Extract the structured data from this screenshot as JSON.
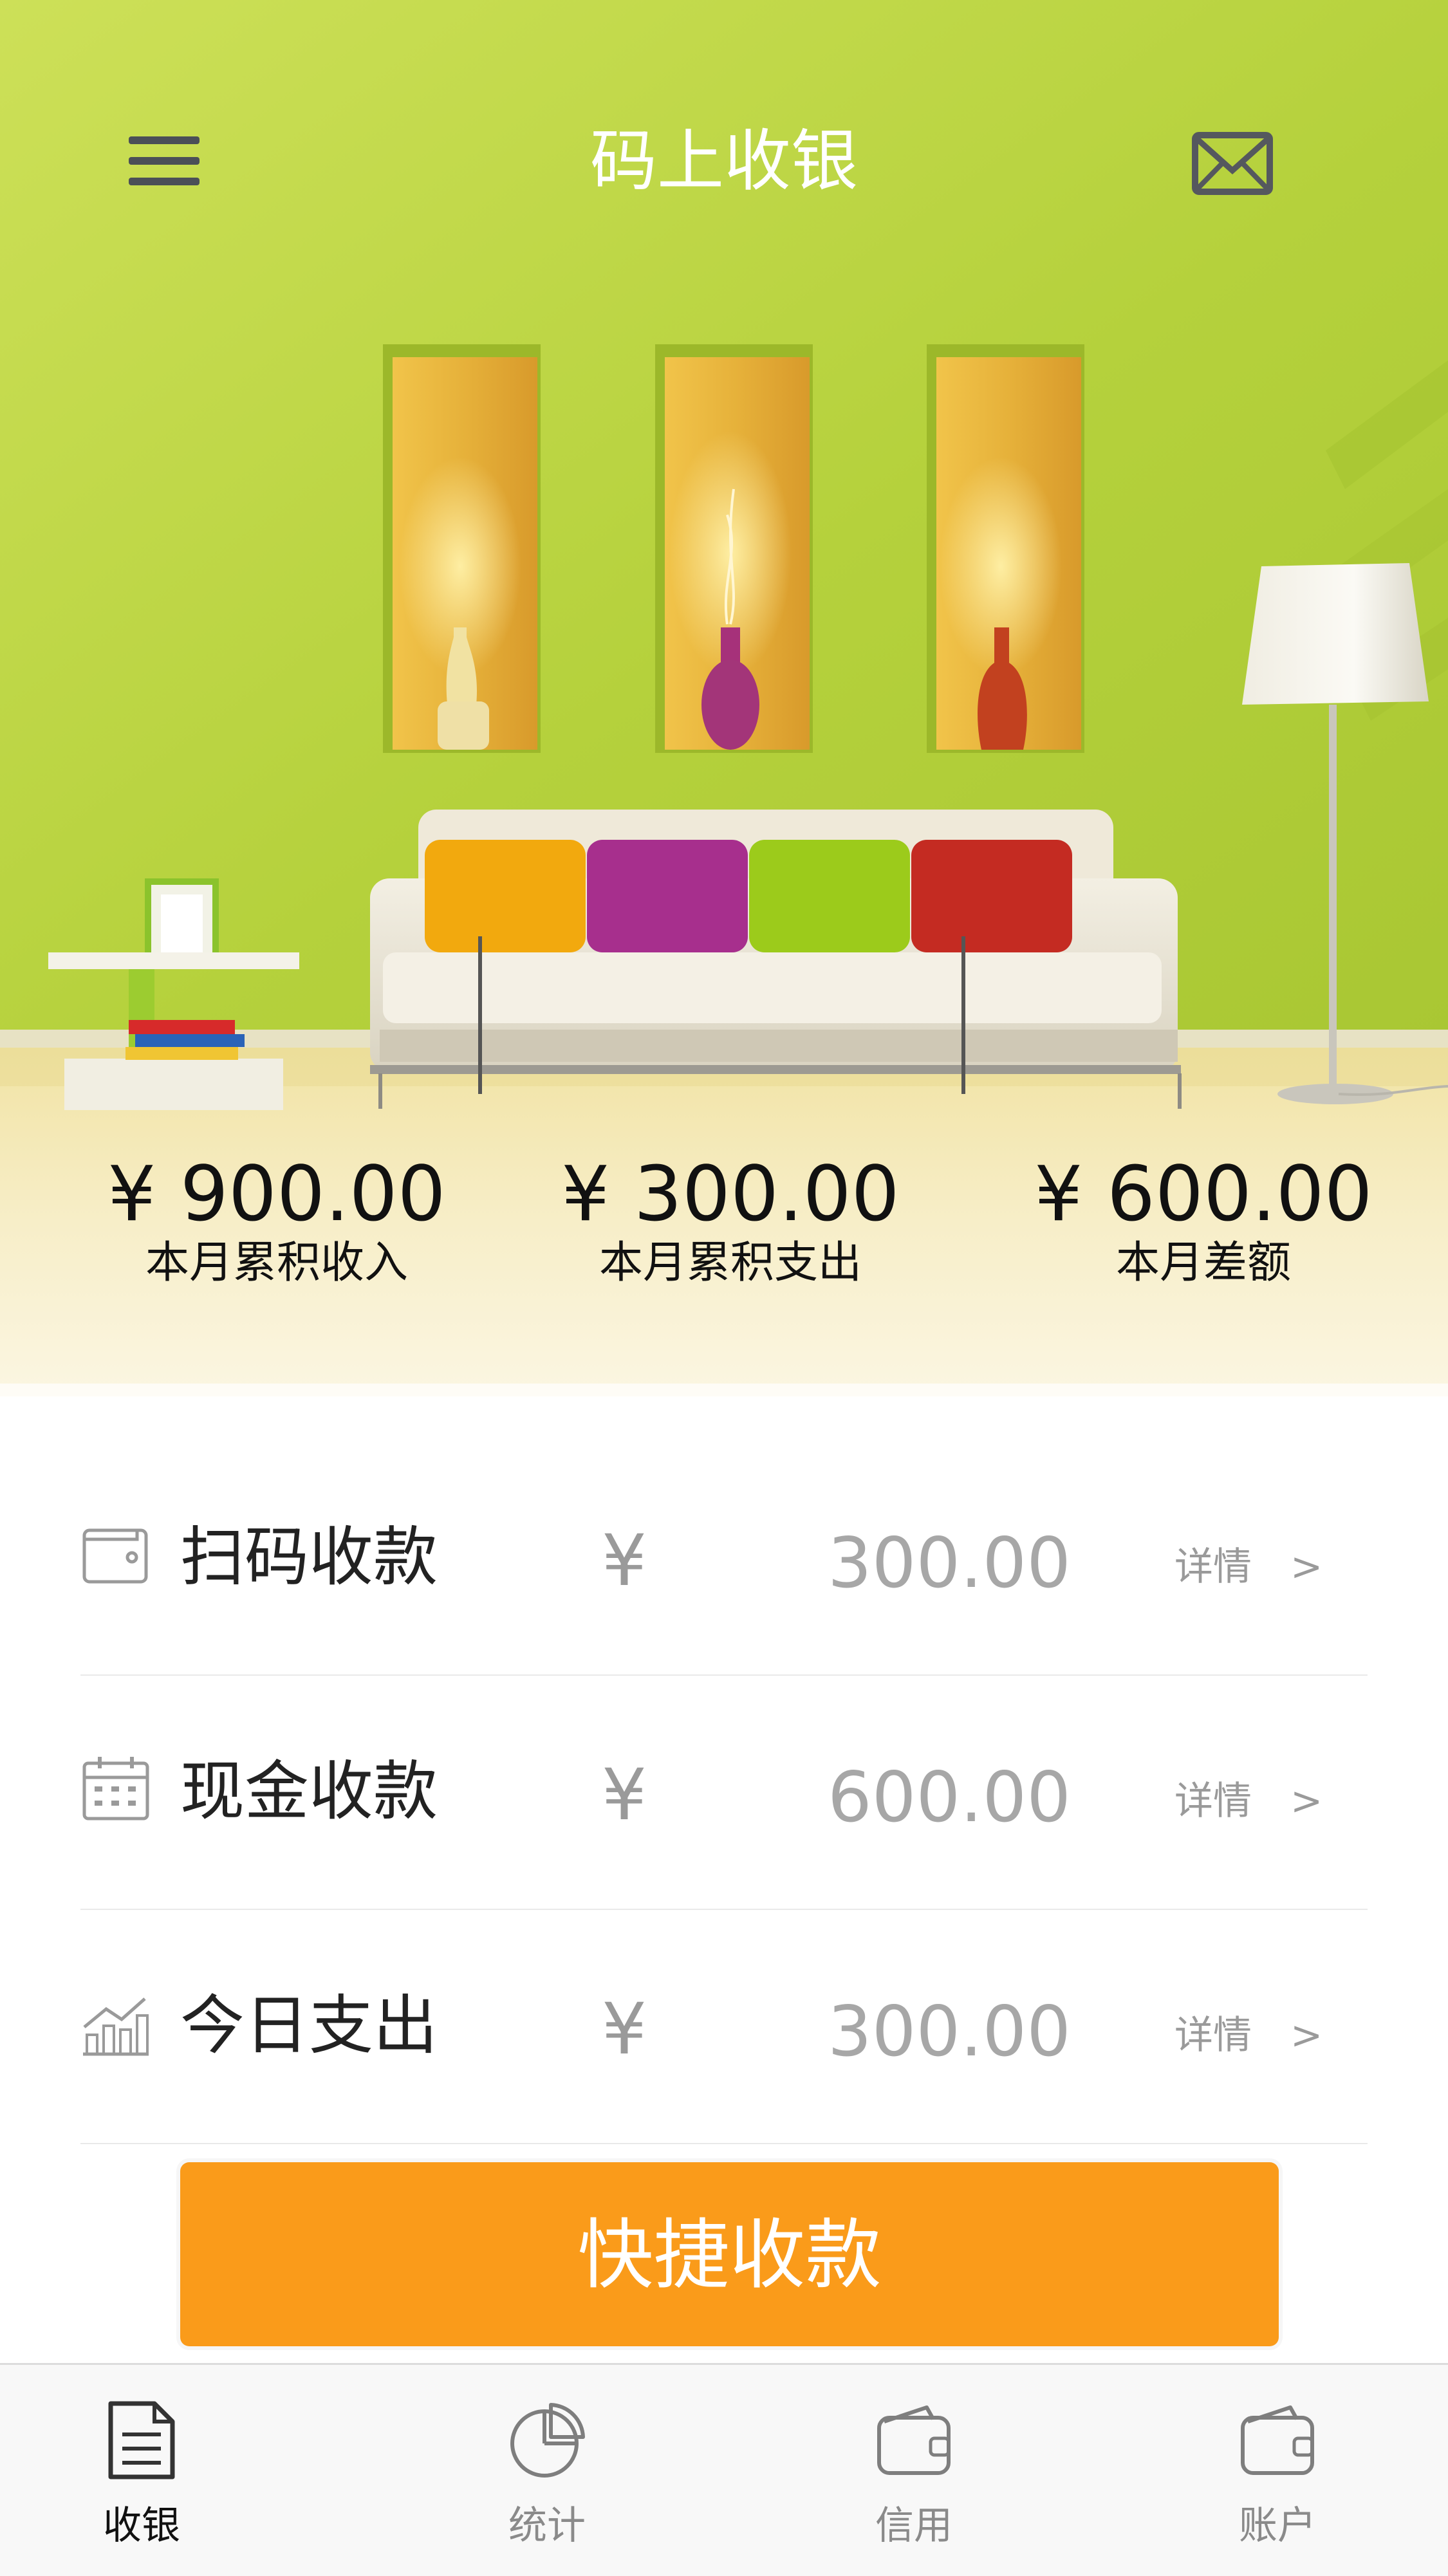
{
  "header": {
    "title": "码上收银",
    "menu_icon": "hamburger-menu-icon",
    "mail_icon": "envelope-icon"
  },
  "summary": [
    {
      "amount": "¥ 900.00",
      "label": "本月累积收入"
    },
    {
      "amount": "¥ 300.00",
      "label": "本月累积支出"
    },
    {
      "amount": "¥ 600.00",
      "label": "本月差额"
    }
  ],
  "rows": [
    {
      "icon": "wallet-icon",
      "label": "扫码收款",
      "currency": "¥",
      "amount": "300.00",
      "detail": "详情",
      "arrow": ">"
    },
    {
      "icon": "calendar-icon",
      "label": "现金收款",
      "currency": "¥",
      "amount": "600.00",
      "detail": "详情",
      "arrow": ">"
    },
    {
      "icon": "bar-chart-icon",
      "label": "今日支出",
      "currency": "¥",
      "amount": "300.00",
      "detail": "详情",
      "arrow": ">"
    }
  ],
  "quick_button": {
    "label": "快捷收款"
  },
  "tabs": [
    {
      "label": "收银",
      "icon": "document-icon",
      "active": true
    },
    {
      "label": "统计",
      "icon": "pie-chart-icon",
      "active": false
    },
    {
      "label": "信用",
      "icon": "wallet-icon",
      "active": false
    },
    {
      "label": "账户",
      "icon": "wallet-icon",
      "active": false
    }
  ],
  "colors": {
    "accent": "#fa9b1a",
    "wall": "#b9d43a",
    "niche": "#e3ae35",
    "floor": "#f3e7b2"
  }
}
